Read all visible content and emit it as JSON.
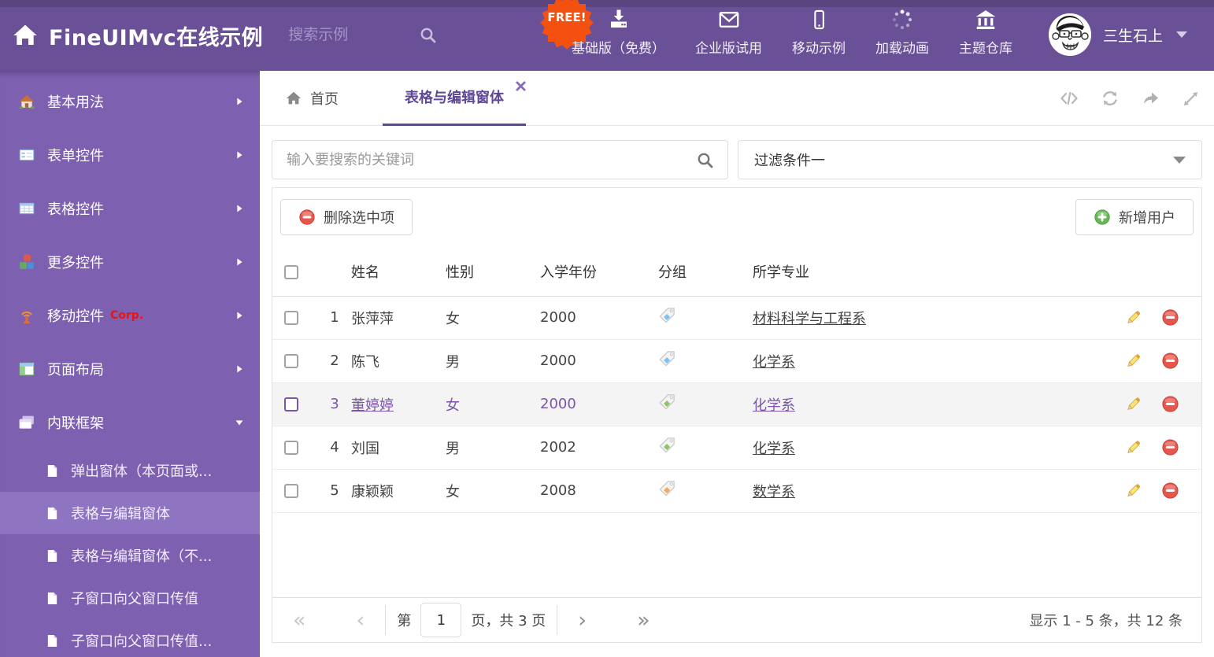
{
  "colors": {
    "header_bg": "#6a5197",
    "sidebar_bg": "#7d60b0",
    "sidebar_active_bg": "#8f74c2",
    "accent_purple": "#5e4896",
    "selected_row_text": "#7a55ab",
    "selected_row_bg": "#f4f4f4",
    "free_badge": "#f4500f",
    "tag_blue": "#7ec1f2",
    "tag_green": "#8fc665",
    "tag_orange": "#f6a85c",
    "delete_red": "#e7564d",
    "add_green": "#67b757",
    "link_text": "#444444"
  },
  "header": {
    "brand": "FineUIMvc在线示例",
    "search_placeholder": "搜索示例",
    "free_badge": "FREE!",
    "nav": [
      {
        "label": "基础版（免费）",
        "icon": "download-icon"
      },
      {
        "label": "企业版试用",
        "icon": "envelope-icon"
      },
      {
        "label": "移动示例",
        "icon": "smartphone-icon"
      },
      {
        "label": "加载动画",
        "icon": "spinner-icon"
      },
      {
        "label": "主题仓库",
        "icon": "bank-icon"
      }
    ],
    "user_name": "三生石上"
  },
  "sidebar": {
    "items": [
      {
        "label": "基本用法",
        "icon": "home-icon"
      },
      {
        "label": "表单控件",
        "icon": "form-icon"
      },
      {
        "label": "表格控件",
        "icon": "table-icon"
      },
      {
        "label": "更多控件",
        "icon": "cubes-icon"
      },
      {
        "label": "移动控件",
        "badge": "Corp.",
        "icon": "antenna-icon"
      },
      {
        "label": "页面布局",
        "icon": "layout-icon"
      },
      {
        "label": "内联框架",
        "icon": "windows-icon"
      }
    ],
    "subitems": [
      {
        "label": "弹出窗体（本页面或..."
      },
      {
        "label": "表格与编辑窗体",
        "selected": "true"
      },
      {
        "label": "表格与编辑窗体（不..."
      },
      {
        "label": "子窗口向父窗口传值"
      },
      {
        "label": "子窗口向父窗口传值..."
      }
    ]
  },
  "tabs": {
    "home_label": "首页",
    "active_label": "表格与编辑窗体"
  },
  "panel": {
    "search_placeholder": "输入要搜索的关键词",
    "filter_value": "过滤条件一",
    "delete_selected_label": "删除选中项",
    "add_user_label": "新增用户"
  },
  "table": {
    "columns": {
      "name": "姓名",
      "gender": "性别",
      "year": "入学年份",
      "group": "分组",
      "major": "所学专业"
    },
    "rows": [
      {
        "num": "1",
        "name": "张萍萍",
        "gender": "女",
        "year": "2000",
        "tag": "blue",
        "major": "材料科学与工程系"
      },
      {
        "num": "2",
        "name": "陈飞",
        "gender": "男",
        "year": "2000",
        "tag": "blue",
        "major": "化学系"
      },
      {
        "num": "3",
        "name": "董婷婷",
        "gender": "女",
        "year": "2000",
        "tag": "green",
        "major": "化学系",
        "selected": "true"
      },
      {
        "num": "4",
        "name": "刘国",
        "gender": "男",
        "year": "2002",
        "tag": "green",
        "major": "化学系"
      },
      {
        "num": "5",
        "name": "康颖颖",
        "gender": "女",
        "year": "2008",
        "tag": "orange",
        "major": "数学系"
      }
    ]
  },
  "pagination": {
    "first": "«",
    "prev": "‹",
    "next": "›",
    "last": "»",
    "page_prefix": "第",
    "page_value": "1",
    "page_suffix": "页，共 3 页",
    "summary": "显示 1 - 5 条，共 12 条"
  }
}
